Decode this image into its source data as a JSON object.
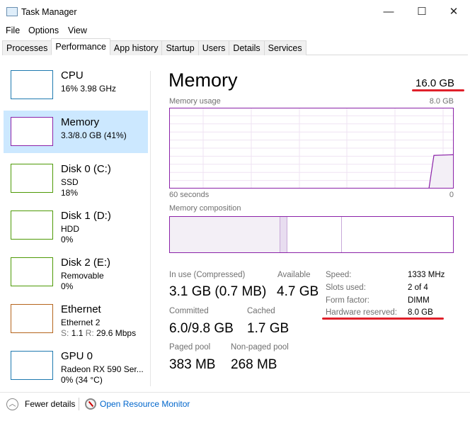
{
  "window": {
    "title": "Task Manager",
    "controls": [
      "—",
      "☐",
      "✕"
    ]
  },
  "menu": [
    "File",
    "Options",
    "View"
  ],
  "tabs": [
    "Processes",
    "Performance",
    "App history",
    "Startup",
    "Users",
    "Details",
    "Services"
  ],
  "active_tab": "Performance",
  "sidebar": {
    "items": [
      {
        "name": "CPU",
        "line1": "16% 3.98 GHz",
        "line2": "",
        "color": "#1f7ab0"
      },
      {
        "name": "Memory",
        "line1": "3.3/8.0 GB (41%)",
        "line2": "",
        "color": "#8b22a8",
        "selected": true
      },
      {
        "name": "Disk 0 (C:)",
        "line1": "SSD",
        "line2": "18%",
        "color": "#4e9a06"
      },
      {
        "name": "Disk 1 (D:)",
        "line1": "HDD",
        "line2": "0%",
        "color": "#4e9a06"
      },
      {
        "name": "Disk 2 (E:)",
        "line1": "Removable",
        "line2": "0%",
        "color": "#4e9a06"
      },
      {
        "name": "Ethernet",
        "line1": "Ethernet 2",
        "line2_s": "S:",
        "line2_sv": "1.1",
        "line2_r": "R:",
        "line2_rv": "29.6 Mbps",
        "color": "#b5651d"
      },
      {
        "name": "GPU 0",
        "line1": "Radeon RX 590 Ser...",
        "line2": "0% (34 °C)",
        "color": "#1f7ab0"
      }
    ]
  },
  "main": {
    "title": "Memory",
    "total": "16.0 GB",
    "usage_label": "Memory usage",
    "usage_max": "8.0 GB",
    "time_left": "60 seconds",
    "time_right": "0",
    "usage_percent": 41,
    "composition_label": "Memory composition",
    "stats": {
      "in_use_label": "In use (Compressed)",
      "in_use": "3.1 GB (0.7 MB)",
      "available_label": "Available",
      "available": "4.7 GB",
      "committed_label": "Committed",
      "committed": "6.0/9.8 GB",
      "cached_label": "Cached",
      "cached": "1.7 GB",
      "paged_label": "Paged pool",
      "paged": "383 MB",
      "nonpaged_label": "Non-paged pool",
      "nonpaged": "268 MB"
    },
    "specs": [
      {
        "k": "Speed:",
        "v": "1333 MHz"
      },
      {
        "k": "Slots used:",
        "v": "2 of 4"
      },
      {
        "k": "Form factor:",
        "v": "DIMM"
      },
      {
        "k": "Hardware reserved:",
        "v": "8.0 GB"
      }
    ],
    "accent": "#8b22a8"
  },
  "footer": {
    "fewer": "Fewer details",
    "monitor": "Open Resource Monitor"
  }
}
